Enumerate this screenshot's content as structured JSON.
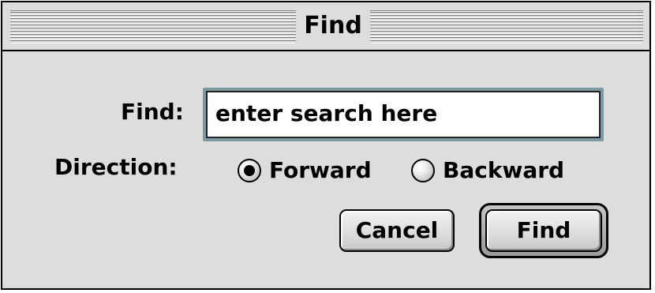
{
  "window": {
    "title": "Find"
  },
  "form": {
    "find_label": "Find:",
    "find_value": "enter search here",
    "direction_label": "Direction:",
    "direction_options": [
      {
        "label": "Forward",
        "selected": true
      },
      {
        "label": "Backward",
        "selected": false
      }
    ]
  },
  "buttons": {
    "cancel_label": "Cancel",
    "find_label": "Find"
  },
  "colors": {
    "window_bg": "#dddddd",
    "field_focus_ring": "#7e9aa0"
  }
}
